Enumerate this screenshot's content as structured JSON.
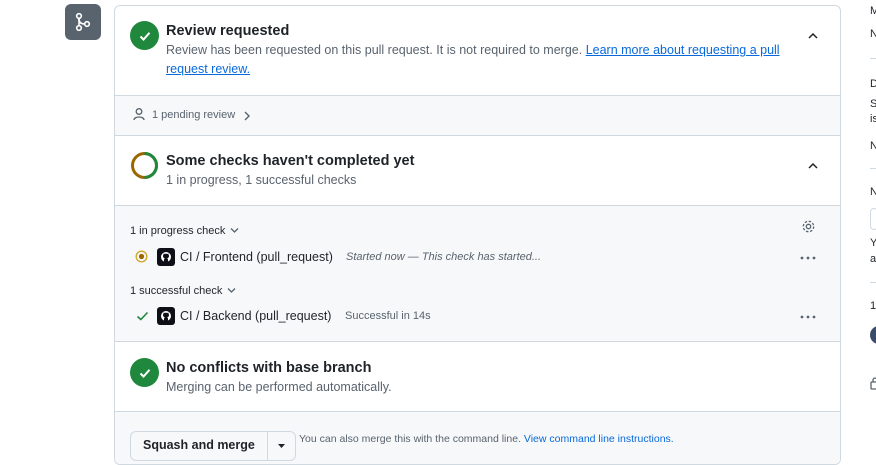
{
  "review": {
    "title": "Review requested",
    "desc": "Review has been requested on this pull request. It is not required to merge.",
    "link": "Learn more about requesting a pull request review."
  },
  "pending": {
    "label": "1 pending review"
  },
  "checks": {
    "title": "Some checks haven't completed yet",
    "subtitle": "1 in progress, 1 successful checks",
    "in_progress_group": "1 in progress check",
    "successful_group": "1 successful check",
    "items": [
      {
        "name": "CI / Frontend (pull_request)",
        "status": "Started now — This check has started..."
      },
      {
        "name": "CI / Backend (pull_request)",
        "status": "Successful in 14s"
      }
    ]
  },
  "conflicts": {
    "title": "No conflicts with base branch",
    "desc": "Merging can be performed automatically."
  },
  "merge": {
    "button": "Squash and merge",
    "note": "You can also merge this with the command line.",
    "link": "View command line instructions."
  },
  "right_column": {
    "letters": [
      "M",
      "N",
      "D",
      "S",
      "is",
      "N",
      "N",
      "Y",
      "a",
      "1"
    ]
  },
  "colors": {
    "success": "#1f883d",
    "pending": "#9a6700",
    "link": "#0969da"
  }
}
